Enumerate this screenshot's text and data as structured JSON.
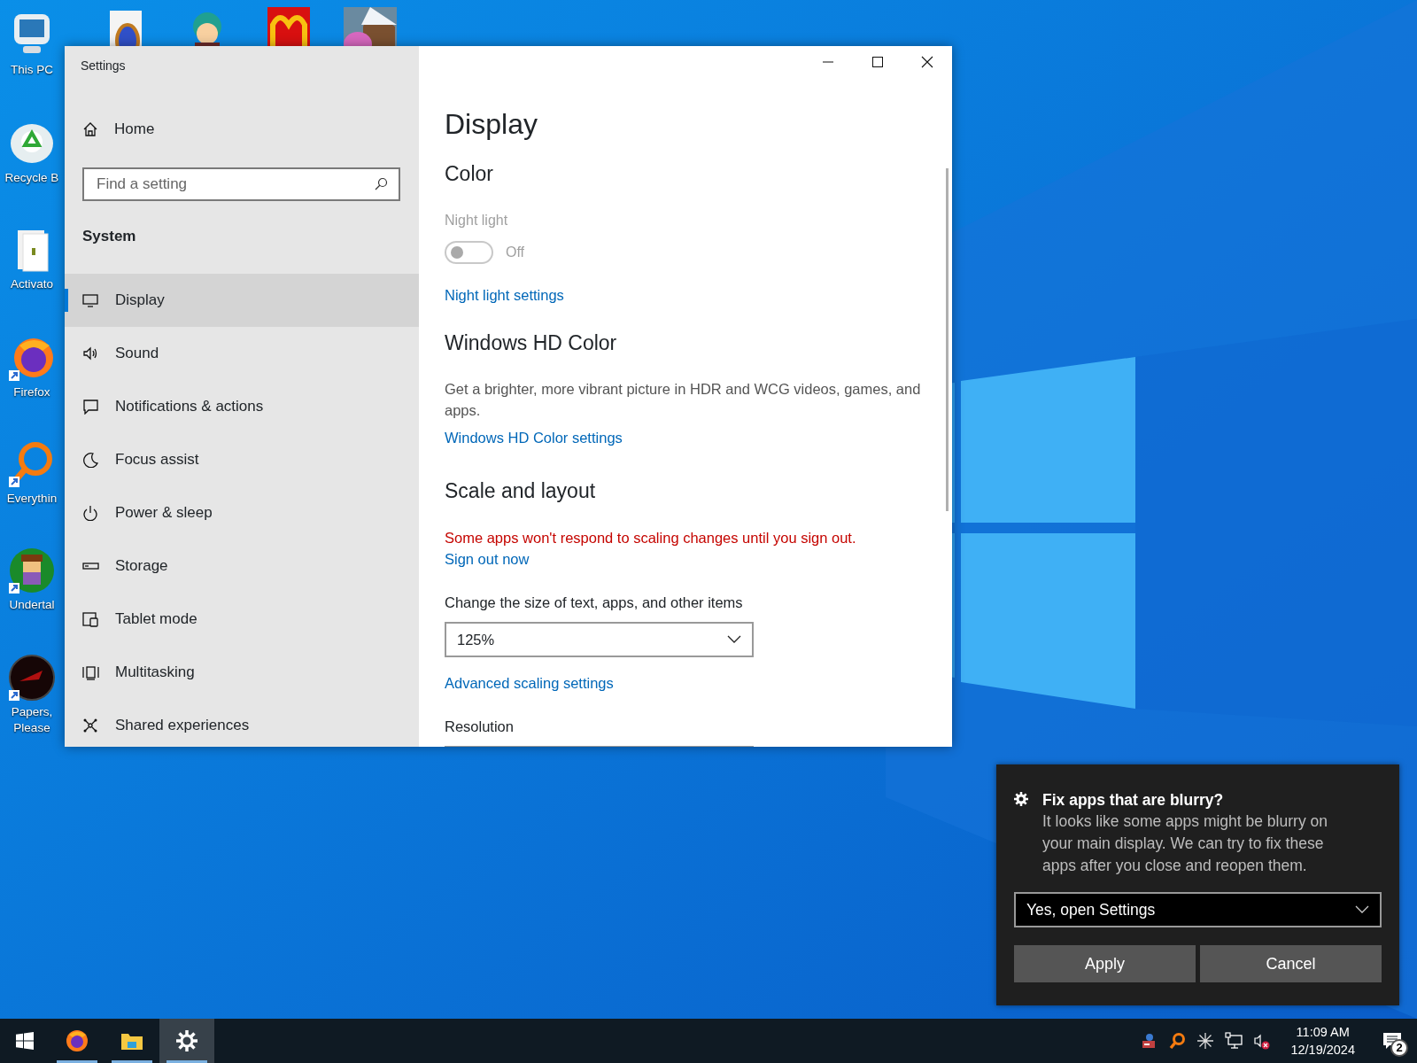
{
  "desktop_icons": [
    {
      "label": "This PC",
      "shortcut": false
    },
    {
      "label": "Recycle B",
      "shortcut": false
    },
    {
      "label": "Activato",
      "shortcut": false
    },
    {
      "label": "Firefox",
      "shortcut": true
    },
    {
      "label": "Everythin",
      "shortcut": true
    },
    {
      "label": "Undertal",
      "shortcut": true
    },
    {
      "label": "Papers, Please",
      "shortcut": true
    }
  ],
  "settings_window": {
    "title": "Settings",
    "sidebar": {
      "home": "Home",
      "search": {
        "placeholder": "Find a setting"
      },
      "section": "System",
      "items": [
        {
          "label": "Display",
          "selected": true
        },
        {
          "label": "Sound",
          "selected": false
        },
        {
          "label": "Notifications & actions",
          "selected": false
        },
        {
          "label": "Focus assist",
          "selected": false
        },
        {
          "label": "Power & sleep",
          "selected": false
        },
        {
          "label": "Storage",
          "selected": false
        },
        {
          "label": "Tablet mode",
          "selected": false
        },
        {
          "label": "Multitasking",
          "selected": false
        },
        {
          "label": "Shared experiences",
          "selected": false
        }
      ]
    },
    "page_title": "Display",
    "blocks": [
      {
        "kind": "heading",
        "text": "Color"
      },
      {
        "kind": "toggle",
        "label": "Night light",
        "on": false,
        "disabled": true,
        "state_text": "Off"
      },
      {
        "kind": "link",
        "text": "Night light settings"
      },
      {
        "kind": "heading",
        "text": "Windows HD Color"
      },
      {
        "kind": "text",
        "text": "Get a brighter, more vibrant picture in HDR and WCG videos, games, and apps."
      },
      {
        "kind": "link",
        "text": "Windows HD Color settings"
      },
      {
        "kind": "heading",
        "text": "Scale and layout"
      },
      {
        "kind": "warning",
        "text": "Some apps won't respond to scaling changes until you sign out."
      },
      {
        "kind": "link",
        "text": "Sign out now"
      },
      {
        "kind": "label",
        "text": "Change the size of text, apps, and other items"
      },
      {
        "kind": "dropdown",
        "value": "125%"
      },
      {
        "kind": "link",
        "text": "Advanced scaling settings"
      },
      {
        "kind": "label",
        "text": "Resolution"
      },
      {
        "kind": "dropdown"
      }
    ]
  },
  "toast": {
    "title": "Fix apps that are blurry?",
    "body": "It looks like some apps might be blurry on your main display. We can try to fix these apps after you close and reopen them.",
    "dropdown": {
      "value": "Yes, open Settings"
    },
    "buttons": [
      "Apply",
      "Cancel"
    ]
  },
  "taskbar": {
    "apps": [
      {
        "selected": false,
        "running": true
      },
      {
        "selected": false,
        "running": true
      },
      {
        "selected": true,
        "running": true
      }
    ],
    "time": "11:09 AM",
    "date": "12/19/2024",
    "notification_count": "2"
  }
}
